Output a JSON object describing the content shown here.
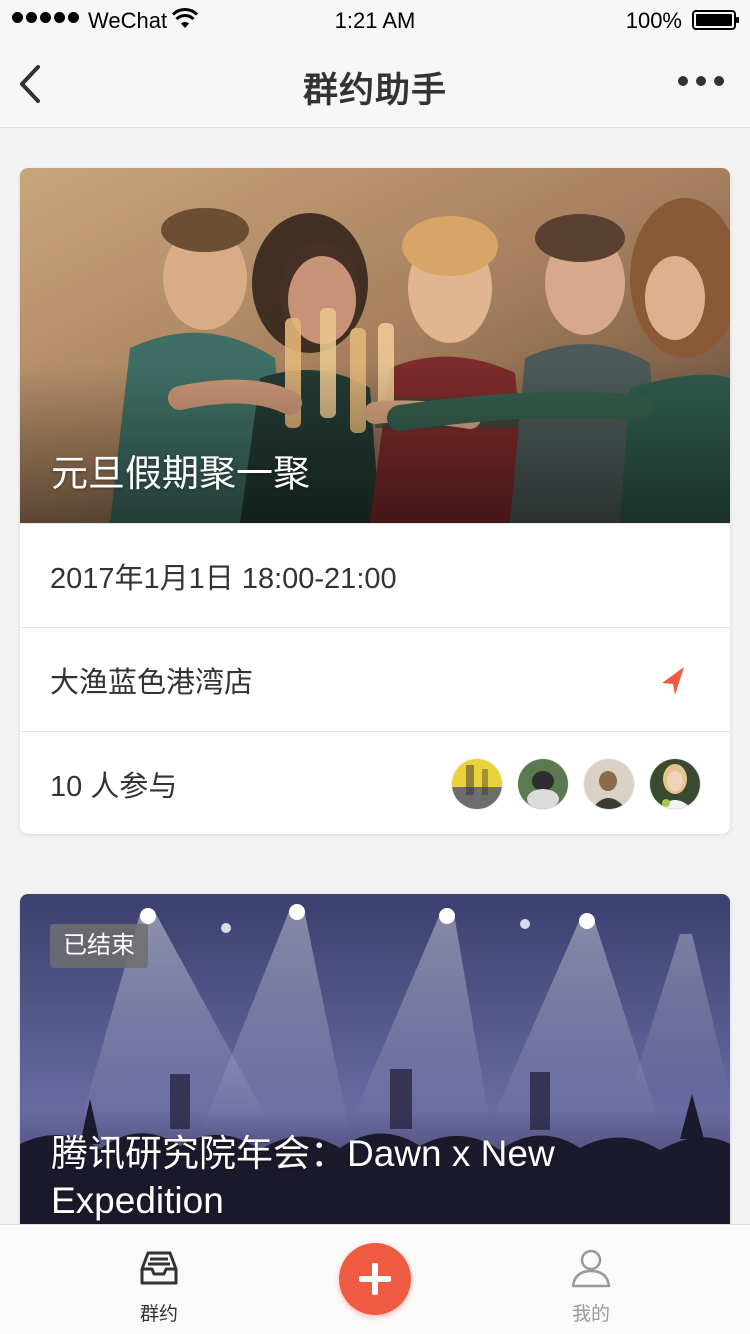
{
  "status_bar": {
    "carrier": "WeChat",
    "time": "1:21 AM",
    "battery": "100%"
  },
  "nav": {
    "title": "群约助手"
  },
  "events": [
    {
      "title": "元旦假期聚一聚",
      "datetime": "2017年1月1日 18:00-21:00",
      "location": "大渔蓝色港湾店",
      "participants": "10 人参与"
    },
    {
      "status": "已结束",
      "title": "腾讯研究院年会：Dawn x New Expedition"
    }
  ],
  "tabbar": {
    "home_label": "群约",
    "me_label": "我的"
  },
  "colors": {
    "accent": "#ef5a43",
    "background": "#f2f2f2"
  }
}
